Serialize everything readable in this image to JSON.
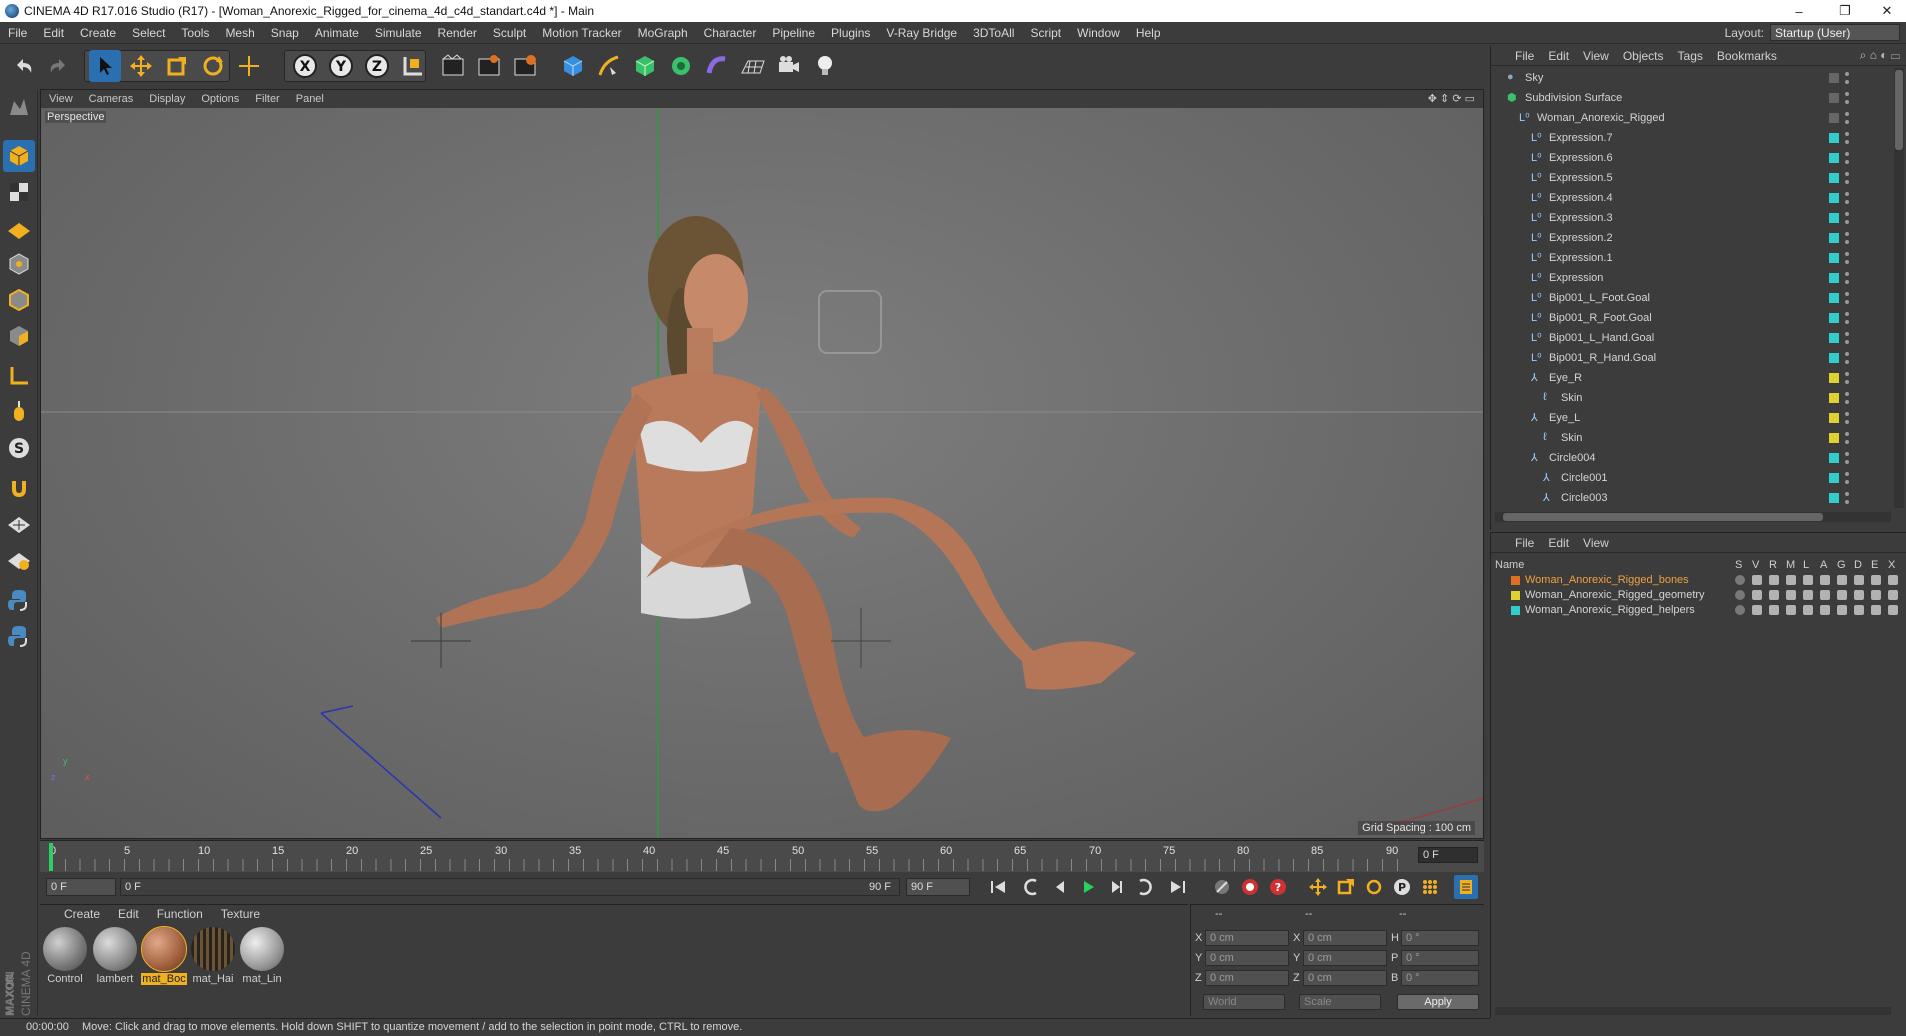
{
  "window": {
    "title": "CINEMA 4D R17.016 Studio (R17) - [Woman_Anorexic_Rigged_for_cinema_4d_c4d_standart.c4d *] - Main",
    "minimize": "–",
    "maximize": "❐",
    "close": "✕"
  },
  "menubar": [
    "File",
    "Edit",
    "Create",
    "Select",
    "Tools",
    "Mesh",
    "Snap",
    "Animate",
    "Simulate",
    "Render",
    "Sculpt",
    "Motion Tracker",
    "MoGraph",
    "Character",
    "Pipeline",
    "Plugins",
    "V-Ray Bridge",
    "3DToAll",
    "Script",
    "Window",
    "Help"
  ],
  "layout": {
    "label": "Layout:",
    "value": "Startup (User)"
  },
  "viewport": {
    "menu": [
      "View",
      "Cameras",
      "Display",
      "Options",
      "Filter",
      "Panel"
    ],
    "label": "Perspective",
    "grid_spacing": "Grid Spacing : 100 cm",
    "axis_y": "y",
    "axis_x": "x",
    "axis_z": "z"
  },
  "timeline": {
    "ticks": [
      "0",
      "5",
      "10",
      "15",
      "20",
      "25",
      "30",
      "35",
      "40",
      "45",
      "50",
      "55",
      "60",
      "65",
      "70",
      "75",
      "80",
      "85",
      "90"
    ],
    "current_frame": "0 F",
    "start_field": "0 F",
    "range_start": "0 F",
    "range_end": "90 F",
    "end_field": "90 F"
  },
  "material_panel": {
    "menu": [
      "Create",
      "Edit",
      "Function",
      "Texture"
    ],
    "materials": [
      {
        "name": "Control",
        "color": "#9a9a9a"
      },
      {
        "name": "lambert",
        "color": "#a6a6a6"
      },
      {
        "name": "mat_Boc",
        "color": "#b77c5e"
      },
      {
        "name": "mat_Hai",
        "color": "#4a3a2a"
      },
      {
        "name": "mat_Lin",
        "color": "#bcbcbc"
      }
    ]
  },
  "coords": {
    "headers": [
      "--",
      "--",
      "--"
    ],
    "rows": [
      {
        "a": "X",
        "av": "0 cm",
        "b": "X",
        "bv": "0 cm",
        "c": "H",
        "cv": "0 °"
      },
      {
        "a": "Y",
        "av": "0 cm",
        "b": "Y",
        "bv": "0 cm",
        "c": "P",
        "cv": "0 °"
      },
      {
        "a": "Z",
        "av": "0 cm",
        "b": "Z",
        "bv": "0 cm",
        "c": "B",
        "cv": "0 °"
      }
    ],
    "world": "World",
    "scale": "Scale",
    "apply": "Apply"
  },
  "status": {
    "time": "00:00:00",
    "message": "Move: Click and drag to move elements. Hold down SHIFT to quantize movement / add to the selection in point mode, CTRL to remove."
  },
  "branding": {
    "maxon": "MAXON",
    "c4d": "CINEMA 4D"
  },
  "object_manager": {
    "menu": [
      "File",
      "Edit",
      "View",
      "Objects",
      "Tags",
      "Bookmarks"
    ],
    "objects": [
      {
        "name": "Sky",
        "indent": 0,
        "color": ""
      },
      {
        "name": "Subdivision Surface",
        "indent": 0,
        "color": ""
      },
      {
        "name": "Woman_Anorexic_Rigged",
        "indent": 1,
        "color": ""
      },
      {
        "name": "Expression.7",
        "indent": 2,
        "color": "#33cccc"
      },
      {
        "name": "Expression.6",
        "indent": 2,
        "color": "#33cccc"
      },
      {
        "name": "Expression.5",
        "indent": 2,
        "color": "#33cccc"
      },
      {
        "name": "Expression.4",
        "indent": 2,
        "color": "#33cccc"
      },
      {
        "name": "Expression.3",
        "indent": 2,
        "color": "#33cccc"
      },
      {
        "name": "Expression.2",
        "indent": 2,
        "color": "#33cccc"
      },
      {
        "name": "Expression.1",
        "indent": 2,
        "color": "#33cccc"
      },
      {
        "name": "Expression",
        "indent": 2,
        "color": "#33cccc"
      },
      {
        "name": "Bip001_L_Foot.Goal",
        "indent": 2,
        "color": "#33cccc"
      },
      {
        "name": "Bip001_R_Foot.Goal",
        "indent": 2,
        "color": "#33cccc"
      },
      {
        "name": "Bip001_L_Hand.Goal",
        "indent": 2,
        "color": "#33cccc"
      },
      {
        "name": "Bip001_R_Hand.Goal",
        "indent": 2,
        "color": "#33cccc"
      },
      {
        "name": "Eye_R",
        "indent": 2,
        "color": "#e0d030"
      },
      {
        "name": "Skin",
        "indent": 3,
        "color": "#e0d030"
      },
      {
        "name": "Eye_L",
        "indent": 2,
        "color": "#e0d030"
      },
      {
        "name": "Skin",
        "indent": 3,
        "color": "#e0d030"
      },
      {
        "name": "Circle004",
        "indent": 2,
        "color": "#33cccc"
      },
      {
        "name": "Circle001",
        "indent": 3,
        "color": "#33cccc"
      },
      {
        "name": "Circle003",
        "indent": 3,
        "color": "#33cccc"
      }
    ]
  },
  "layer_manager": {
    "menu": [
      "File",
      "Edit",
      "View"
    ],
    "name_header": "Name",
    "cols": [
      "S",
      "V",
      "R",
      "M",
      "L",
      "A",
      "G",
      "D",
      "E",
      "X"
    ],
    "layers": [
      {
        "name": "Woman_Anorexic_Rigged_bones",
        "color": "#e07020",
        "active": true
      },
      {
        "name": "Woman_Anorexic_Rigged_geometry",
        "color": "#e0d030",
        "active": false
      },
      {
        "name": "Woman_Anorexic_Rigged_helpers",
        "color": "#33cccc",
        "active": false
      }
    ]
  }
}
